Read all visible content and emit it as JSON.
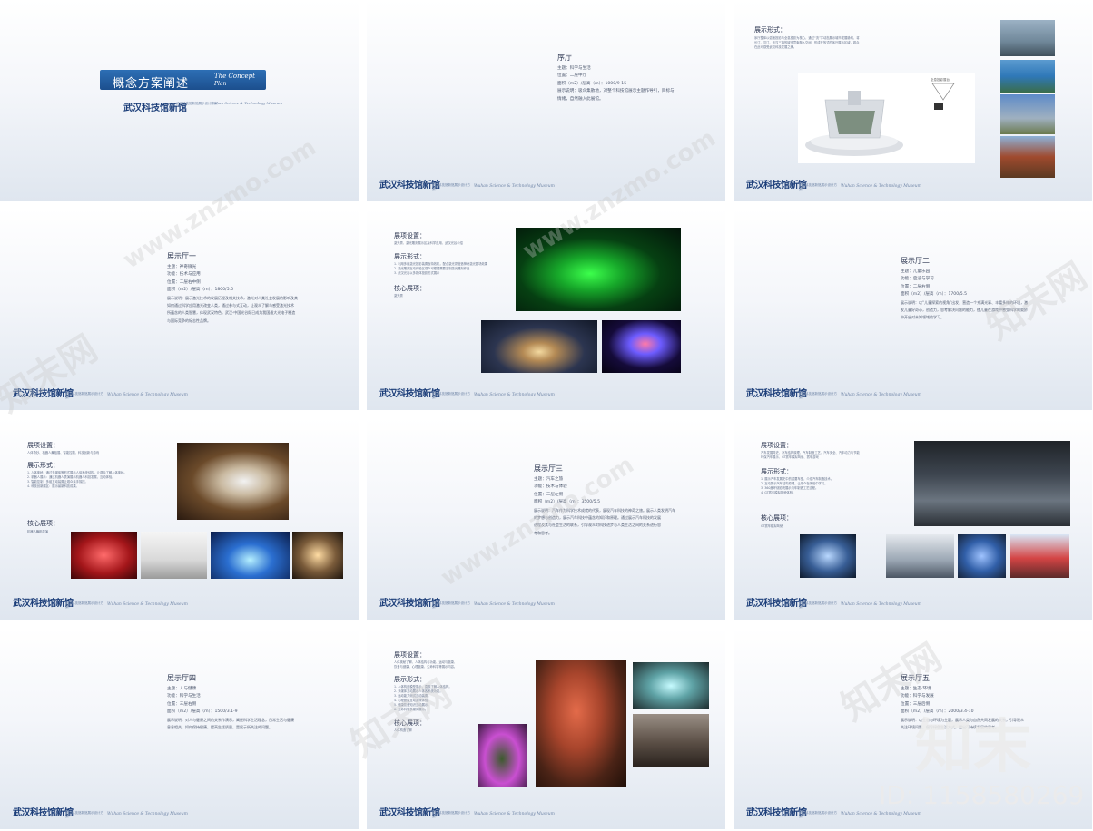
{
  "brand": {
    "logo": "武汉科技馆新馆",
    "sub": "武汉科技馆新馆展示设计方案",
    "en": "Wuhan Science & Technology Museum"
  },
  "cover": {
    "title_cn": "概念方案阐述",
    "title_en_1": "The Concept",
    "title_en_2": "Plan"
  },
  "s2": {
    "title": "序厅",
    "lines": [
      "主题：科学与生活",
      "位置：二层中厅",
      "面积（m2）/层高（m）：1000/9-15",
      "展示说明：吸众集散地，对整个科技馆展示主题作导引，目标与",
      "情绪，自然融入此展馆。"
    ]
  },
  "s3": {
    "heading": "展示形式：",
    "para": [
      "序厅整体以弧面投影与全息投影为核心，通过“流”字动态展示城市发展脉络，将",
      "长江、汉江、武汉三镇的城市意象融入空间，形成开放式的序厅展示区域，观众",
      "在此可感受武汉科技发展之美。"
    ],
    "tag": "全息投影展台"
  },
  "s4": {
    "title": "展示厅一",
    "lines": [
      "主题：神奇微光",
      "功能：技术与应用",
      "位置：二层右中侧",
      "面积（m2）/层高（m）：1800/5.5",
      "展示说明：展示激光技术的发展历程及相关技术，激光对人类社会发展的影响及其",
      "如何通过科学应用激光改变人类，通过参与式互动，让观众了解与感受激光技术",
      "所蕴含的人类智慧，体现武汉特色。武汉·中国光谷既已成为我国最大光电子制造",
      "与国际竞争的标志性品牌。"
    ]
  },
  "s5": {
    "h1": "展项设置：",
    "t1": "激光秀、激光雕刻展示区及科学应用、武汉光谷介绍",
    "h2": "展示形式：",
    "t2": [
      "1. 利用多组激光投影装置及特效机，配合激光雾营造神奇激光剧场效果",
      "2. 激光雕刻互动体验区观众可根据需要定制激光雕刻作品",
      "3. 武汉光谷以多媒体投影形式展示"
    ],
    "h3": "核心展项：",
    "t3": "激光秀"
  },
  "s6": {
    "title": "展示厅二",
    "lines": [
      "主题：儿童乐园",
      "功能：启迪与学习",
      "位置：二层右侧",
      "面积（m2）/层高（m）：1700/5.5",
      "展示说明：以“儿童探索的视角”出发，营造一个充满光彩、丰富多样的环境，激",
      "发儿童好奇心，创造力，思考解决问题的能力，使儿童在游戏中感受科学的奥妙",
      "中开启对未知领域的学习。"
    ]
  },
  "s7": {
    "h1": "展项设置：",
    "t1": "人体奇妙、机器人舞蹈展、智能控制、科技创新与游戏",
    "h2": "展示形式：",
    "t2": [
      "1. 人体奥秘：通过多媒体等形式展示人体系统结构，让观众了解人体奥秘。",
      "2. 机器人展示：通过机器人表演展示机器人科技发展，互动体验。",
      "3. 智能控制：多组互动装置让观众亲手操控。",
      "4. 科技创新展区：展示最新科技成果。"
    ],
    "h3": "核心展项：",
    "t3": "机器人舞蹈表演"
  },
  "s8": {
    "title": "展示厅三",
    "lines": [
      "主题：汽车之旅",
      "功能：技术与体验",
      "位置：三层左侧",
      "面积（m2）/层高（m）：3500/5.5",
      "展示说明：汽车作为科学技术成就的代表，展现汽车科技的神奇之旅。展示人类发明汽车",
      "的梦想与创造力，展示汽车科技中蕴含的知识和原理。通过展示汽车科技的发展",
      "进程及其与社会生活的联系，引导观众对科技进步与人类生活之间的关系进行思",
      "考和思考。"
    ]
  },
  "s9": {
    "h1": "展项设置：",
    "t1": [
      "汽车发展简史、汽车结构原理、汽车制造工艺、汽车安全、汽车动力与节能",
      "环保汽车展示、GT赛车模拟驾驶、赛车游戏"
    ],
    "h2": "展示形式：",
    "t2": [
      "1. 展示汽车发展史中的重要车型，介绍汽车制造技术。",
      "2. 互动展示汽车结构原理，让观众在体验中学习。",
      "3. 360度环绕影院展示汽车制造工艺过程。",
      "4. GT赛车模拟驾驶体验。"
    ],
    "h3": "核心展项：",
    "t3": "GT赛车模拟驾驶"
  },
  "s10": {
    "title": "展示厅四",
    "lines": [
      "主题：人与健康",
      "功能：科学与生活",
      "位置：三层右侧",
      "面积（m2）/层高（m）：1500/3.1-9",
      "展示说明：对人与健康之间的关系作演示，阐述科学生活理念，日常生活与健康",
      "息息相关，如何保持健康，提高生活质量，是展示所关注的问题。"
    ]
  },
  "s11": {
    "h1": "展项设置：",
    "t1": [
      "人体奥秘了解、人体结构与功能、运动与健康、",
      "饮食与健康、心理健康、生命科学等展示内容。"
    ],
    "h2": "展示形式：",
    "t2": [
      "1. 人体构造模型展示，直观了解人体结构。",
      "2. 多媒体互动展示人体各系统功能。",
      "3. 运动能力测试互动装置。",
      "4. 心理健康互动游戏体验。",
      "5. 健康饮食知识互动展示。",
      "6. 生命科学多媒体展示。"
    ],
    "h3": "核心展项：",
    "t3": "人体构造了解"
  },
  "s12": {
    "title": "展示厅五",
    "lines": [
      "主题：生态·环境",
      "功能：科学与发展",
      "位置：三层后侧",
      "面积（m2）/层高（m）：2000/3.4-10",
      "展示说明：以生态与环境为主题，展示人类与自然共同发展的关系，引导观众",
      "关注环境问题，倡导绿色生活方式，提出可持续发展的思考。"
    ]
  },
  "watermark": {
    "site": "www.znzmo.com",
    "cn": "知末网",
    "big": "知末",
    "id": "ID: 1158580269"
  }
}
